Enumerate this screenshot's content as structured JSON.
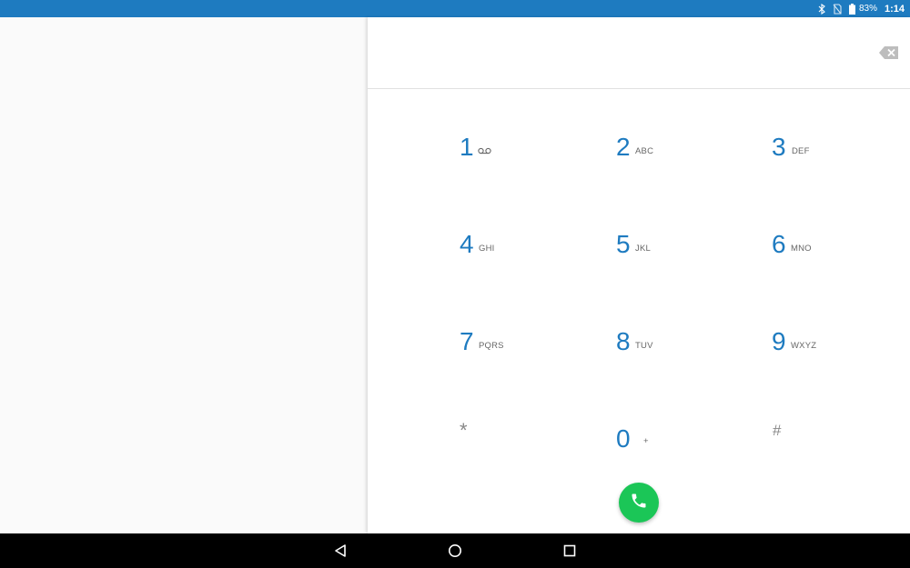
{
  "status_bar": {
    "battery_percent": "83%",
    "time": "1:14",
    "icons": [
      "bluetooth-icon",
      "no-sim-icon",
      "battery-icon"
    ],
    "background_color": "#1e7bc0"
  },
  "digits_field": {
    "value": "",
    "placeholder": ""
  },
  "dialpad": {
    "accent_color": "#1e7bc0",
    "keys": [
      {
        "digit": "1",
        "letters": ""
      },
      {
        "digit": "2",
        "letters": "ABC"
      },
      {
        "digit": "3",
        "letters": "DEF"
      },
      {
        "digit": "4",
        "letters": "GHI"
      },
      {
        "digit": "5",
        "letters": "JKL"
      },
      {
        "digit": "6",
        "letters": "MNO"
      },
      {
        "digit": "7",
        "letters": "PQRS"
      },
      {
        "digit": "8",
        "letters": "TUV"
      },
      {
        "digit": "9",
        "letters": "WXYZ"
      },
      {
        "digit": "*",
        "letters": ""
      },
      {
        "digit": "0",
        "letters": "+"
      },
      {
        "digit": "#",
        "letters": ""
      }
    ]
  },
  "call_button": {
    "icon": "phone-icon",
    "color": "#1bc657"
  },
  "nav_bar": {
    "icons": [
      "back-icon",
      "home-icon",
      "recents-icon"
    ]
  }
}
